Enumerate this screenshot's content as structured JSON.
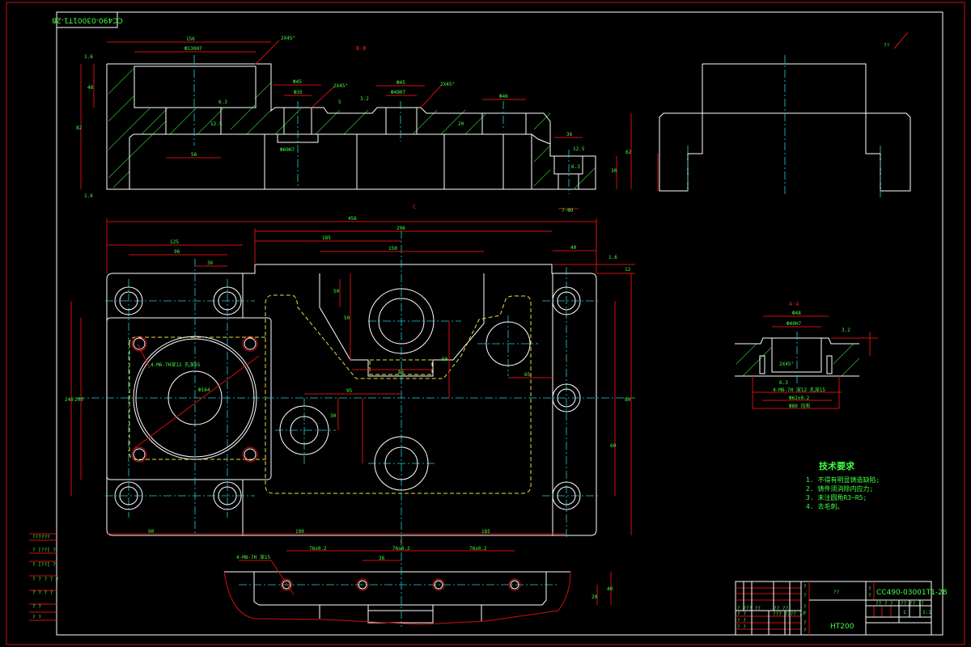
{
  "drawing": {
    "drawing_number": "CC490-03001T1-28",
    "mirrored_number": "CC490-03001T1-28",
    "material": "HT200",
    "part_name": "??",
    "section_bb": "B-B",
    "section_aa": "A-A",
    "view_marker_c": "C",
    "roughness_other": "??"
  },
  "tech_requirements": {
    "title": "技术要求",
    "items": [
      "1. 不得有明显铸造缺陷;",
      "2. 铸件须消除内应力;",
      "3. 未注圆角R3~R5;",
      "4. 去毛刺。"
    ]
  },
  "title_block": {
    "cells": [
      "?",
      "?",
      "?",
      "?",
      "??",
      "?",
      "?",
      "???",
      "??",
      "?? ? ?",
      "?? ?? ??",
      "1",
      "1:1",
      "? ?",
      "? ?",
      "? ?",
      "?",
      "?",
      "?",
      "?",
      "?",
      "? ??? ??",
      "?? ??",
      "??? ???? ??"
    ]
  },
  "left_table": {
    "rows": [
      "??????",
      "? [??] ?",
      "? [??] ?",
      "? ? ? ? ?",
      "? ? ? ?",
      "?  ?",
      "?  ?"
    ]
  },
  "dims": {
    "top_156": "156",
    "top_phi130": "Ф130H7",
    "top_2x45a": "2X45°",
    "top_16a": "1.6",
    "top_48": "48",
    "top_82": "82",
    "top_63a": "6.3",
    "top_125a": "12.5",
    "top_56": "56",
    "top_16b": "1.6",
    "top_phi45a": "Ф45",
    "top_phi35": "Ф35",
    "top_2x45b": "2X45°",
    "top_5": "5",
    "top_32a": "3.2",
    "top_phi45b": "Ф45",
    "top_phi40": "Ф40H7",
    "top_2x45c": "2X45°",
    "top_phi46": "Ф46",
    "top_20": "20",
    "top_phi60": "Ф60H7",
    "top_36": "36",
    "top_125b": "12.5",
    "top_63b": "6.3",
    "top_62": "62",
    "top_30": "30",
    "top_7phi": "7-Ф9",
    "plan_456": "456",
    "plan_296": "296",
    "plan_185": "185",
    "plan_150": "150",
    "plan_125": "125",
    "plan_96": "96",
    "plan_36": "36",
    "plan_40": "40",
    "plan_16": "1.6",
    "plan_12": "12",
    "plan_200": "200",
    "plan_240": "240",
    "plan_90": "90",
    "plan_190": "190",
    "plan_185b": "185",
    "plan_80": "80",
    "plan_phi": "Ф164",
    "plan_4m6": "4-M6-7H深12 孔深15",
    "plan_95": "95",
    "plan_30": "30",
    "plan_65": "65",
    "plan_50a": "50",
    "plan_50b": "50",
    "plan_60": "60",
    "plan_86": "86",
    "plan_60b": "60",
    "bot_a": "76±0.2",
    "bot_b": "76±0.2",
    "bot_c": "76±0.2",
    "bot_36": "36",
    "bot_4m": "4-M8-7H 深15",
    "bot_40": "40",
    "bot_20": "20",
    "aa_phi48": "Ф48",
    "aa_phi40": "Ф40H7",
    "aa_32": "3.2",
    "aa_2x45": "2X45°",
    "aa_63": "6.3",
    "aa_4m": "4-M6-7H 深12 孔深15",
    "aa_phi": "Ф62±0.2",
    "aa_phi80": "Ф80 均布"
  }
}
